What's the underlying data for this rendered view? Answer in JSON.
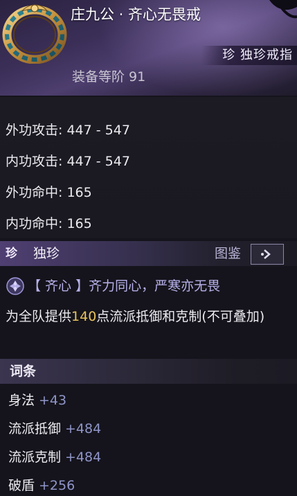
{
  "item": {
    "name": "庄九公 · 齐心无畏戒",
    "rarity_label": "珍 独珍戒指",
    "equip_level": "装备等阶 91"
  },
  "stats": [
    {
      "label": "外功攻击:",
      "value": "447 - 547"
    },
    {
      "label": "内功攻击:",
      "value": "447 - 547"
    },
    {
      "label": "外功命中:",
      "value": "165"
    },
    {
      "label": "内功命中:",
      "value": "165"
    }
  ],
  "set_section": {
    "badge": "珍",
    "title": "独珍",
    "codex_label": "图鉴",
    "effect_name": "【 齐心 】齐力同心，严寒亦无畏",
    "desc_prefix": "为全队提供",
    "desc_value": "140",
    "desc_suffix": "点流派抵御和克制(不可叠加)"
  },
  "affix_section": {
    "title": "词条",
    "items": [
      {
        "name": "身法",
        "value": "+43"
      },
      {
        "name": "流派抵御",
        "value": "+484"
      },
      {
        "name": "流派克制",
        "value": "+484"
      },
      {
        "name": "破盾",
        "value": "+256"
      }
    ]
  },
  "colors": {
    "accent_purple": "#b7b1ea",
    "highlight_gold": "#e8c35c",
    "affix_value_blue": "#8f95c8"
  },
  "icons": {
    "item": "ring-icon",
    "set_effect": "diamond-effect-icon",
    "codex_button": "arrow-right-icon"
  }
}
